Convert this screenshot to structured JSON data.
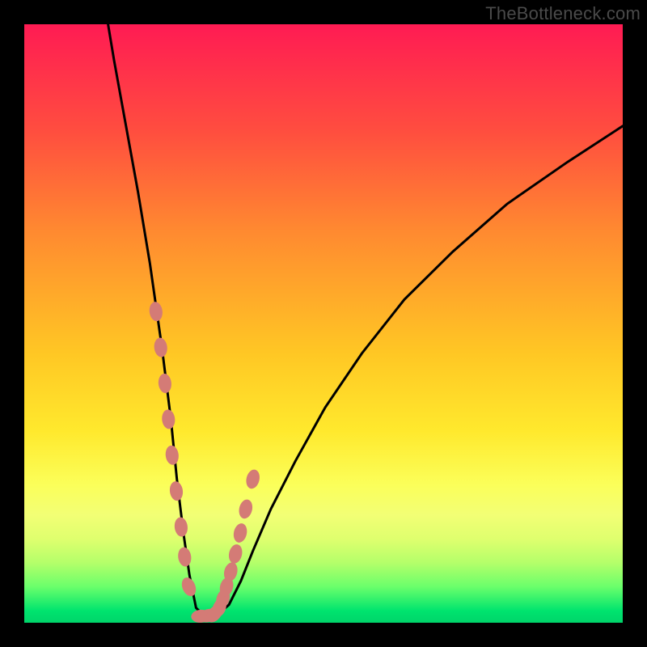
{
  "watermark": "TheBottleneck.com",
  "chart_data": {
    "type": "line",
    "title": "",
    "xlabel": "",
    "ylabel": "",
    "xlim": [
      0,
      100
    ],
    "ylim": [
      0,
      100
    ],
    "series": [
      {
        "name": "curve",
        "x": [
          14,
          15,
          17,
          19,
          21,
          23,
          24.5,
          25.5,
          26.6,
          27.6,
          28.7,
          30.2,
          32.2,
          34.2,
          36.2,
          38.2,
          41.2,
          45.3,
          50.3,
          56.4,
          63.5,
          71.6,
          80.7,
          90.8,
          100
        ],
        "y": [
          100,
          94,
          83,
          72,
          60,
          46,
          34,
          24,
          15,
          8,
          2.5,
          1,
          1.3,
          3,
          7,
          12,
          19,
          27,
          36,
          45,
          54,
          62,
          70,
          77,
          83
        ]
      },
      {
        "name": "markers",
        "x": [
          22.0,
          22.8,
          23.5,
          24.1,
          24.7,
          25.4,
          26.2,
          26.8,
          27.5,
          29.5,
          30.8,
          31.8,
          32.6,
          33.2,
          33.8,
          34.5,
          35.3,
          36.1,
          37.0,
          38.2
        ],
        "y": [
          52,
          46,
          40,
          34,
          28,
          22,
          16,
          11,
          6,
          1.1,
          1.2,
          1.5,
          2.5,
          4.0,
          6.0,
          8.5,
          11.5,
          15.0,
          19.0,
          24.0
        ]
      }
    ],
    "colors": {
      "curve": "#000000",
      "markers": "#d47b76"
    }
  }
}
